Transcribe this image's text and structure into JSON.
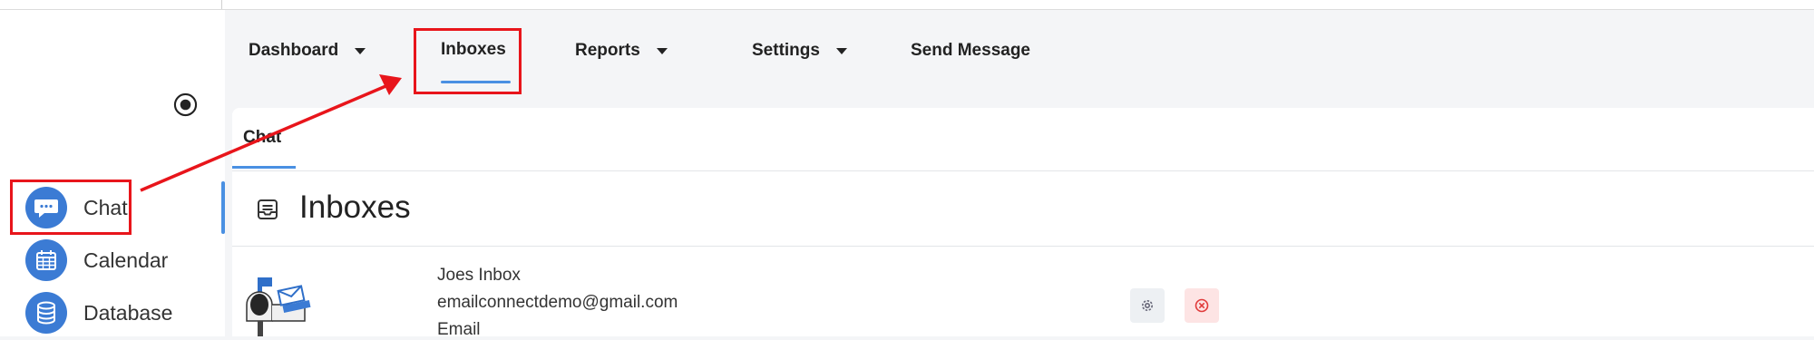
{
  "topnav": {
    "items": [
      {
        "label": "Dashboard",
        "has_caret": true
      },
      {
        "label": "Inboxes",
        "has_caret": false,
        "active": true
      },
      {
        "label": "Reports",
        "has_caret": true
      },
      {
        "label": "Settings",
        "has_caret": true
      },
      {
        "label": "Send Message",
        "has_caret": false
      }
    ]
  },
  "sidebar": {
    "items": [
      {
        "label": "Chat",
        "icon": "chat-bubble-icon",
        "active": true
      },
      {
        "label": "Calendar",
        "icon": "calendar-icon"
      },
      {
        "label": "Database",
        "icon": "database-icon"
      }
    ]
  },
  "content": {
    "tab_label": "Chat",
    "title": "Inboxes",
    "inbox": {
      "name": "Joes Inbox",
      "email": "emailconnectdemo@gmail.com",
      "type": "Email"
    }
  },
  "colors": {
    "accent": "#4a90e2",
    "icon_blue": "#3b7bd4",
    "highlight_red": "#e8151b",
    "delete_bg": "#fde4e4",
    "settings_bg": "#edf0f3"
  }
}
